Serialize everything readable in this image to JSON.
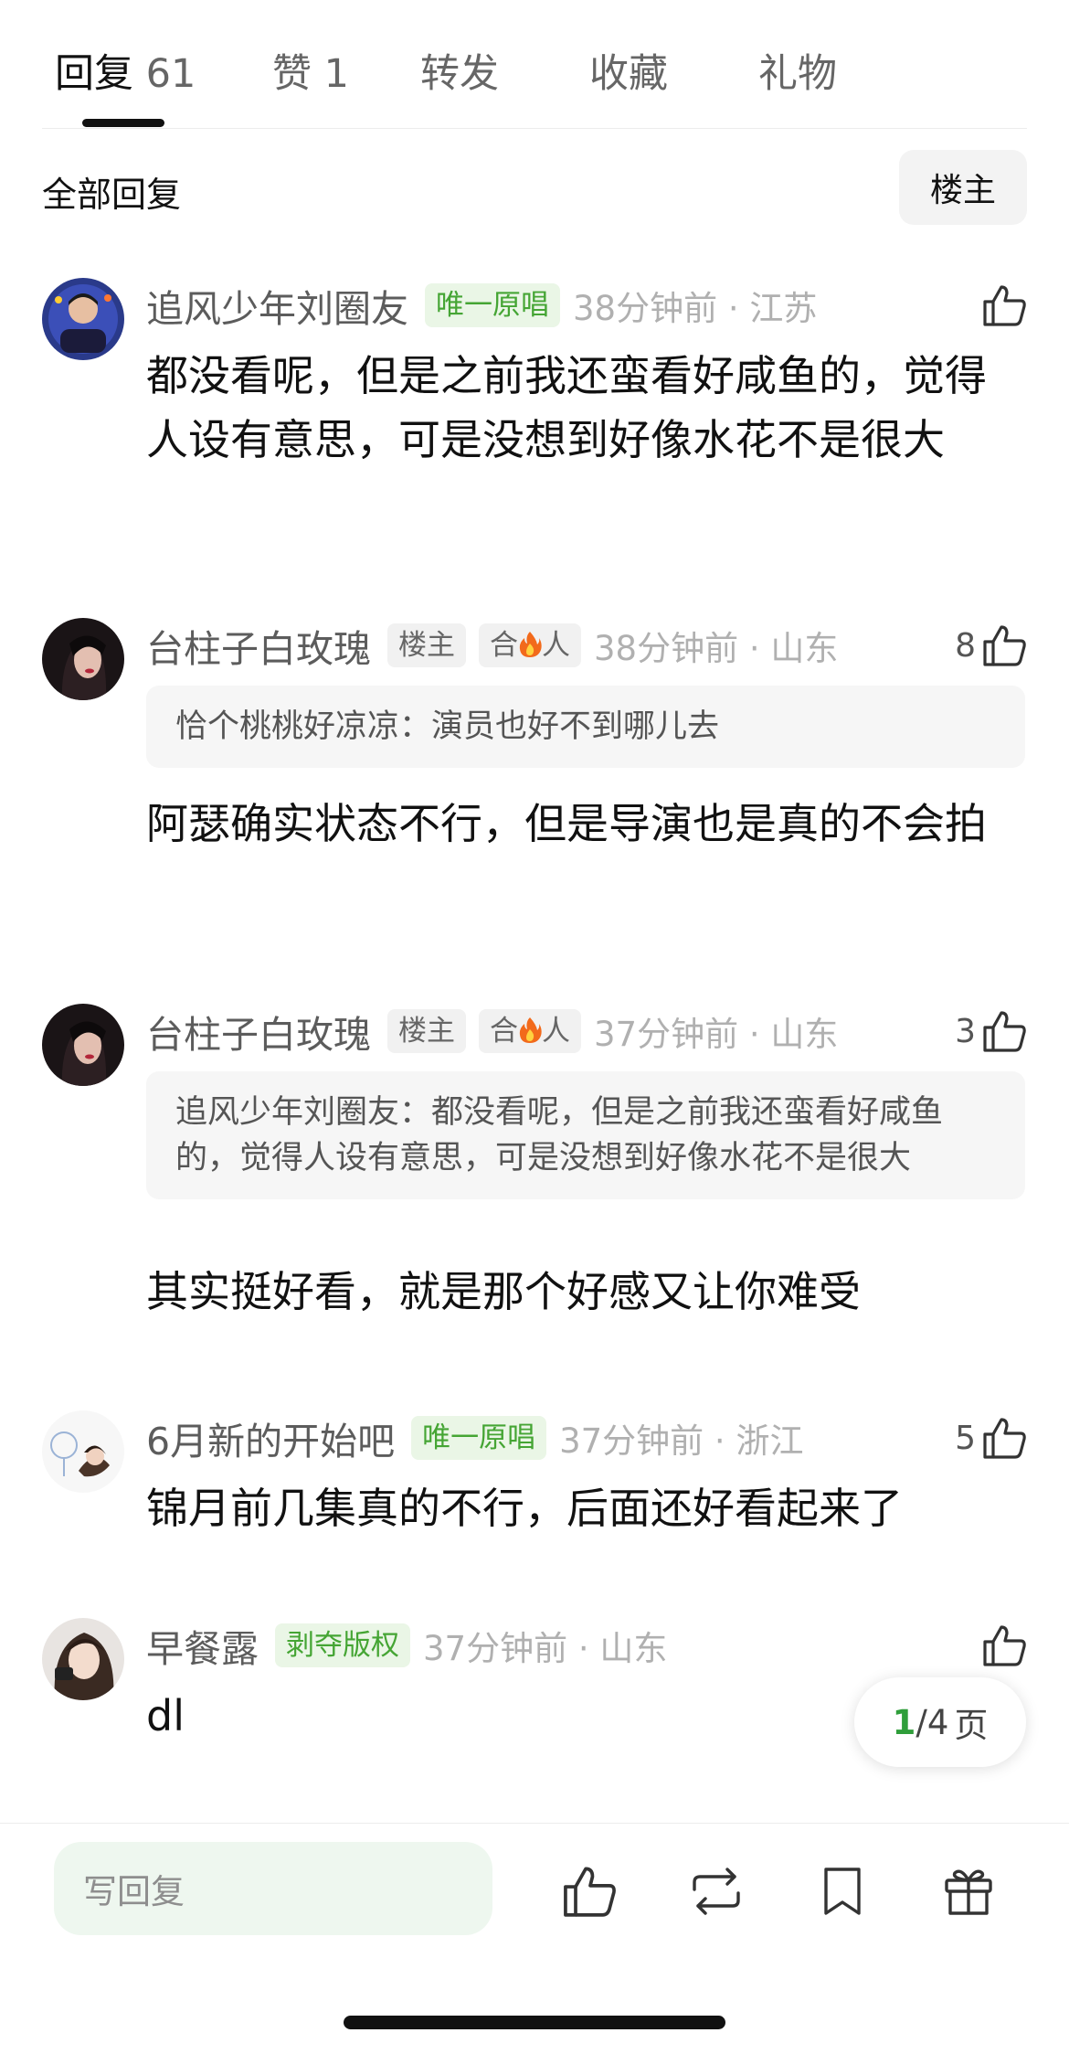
{
  "tabs": [
    {
      "label": "回复",
      "count": "61"
    },
    {
      "label": "赞",
      "count": "1"
    },
    {
      "label": "转发",
      "count": ""
    },
    {
      "label": "收藏",
      "count": ""
    },
    {
      "label": "礼物",
      "count": ""
    }
  ],
  "section_title": "全部回复",
  "filter_button": "楼主",
  "comments": [
    {
      "name": "追风少年刘圈友",
      "badges": [
        "唯一原唱"
      ],
      "time": "38分钟前 · 江苏",
      "likes": "",
      "text": "都没看呢，但是之前我还蛮看好咸鱼的，觉得人设有意思，可是没想到好像水花不是很大"
    },
    {
      "name": "台柱子白玫瑰",
      "badges": [
        "楼主",
        "合",
        "人"
      ],
      "time": "38分钟前 · 山东",
      "likes": "8",
      "quote": "恰个桃桃好凉凉：演员也好不到哪儿去",
      "text": "阿瑟确实状态不行，但是导演也是真的不会拍"
    },
    {
      "name": "台柱子白玫瑰",
      "badges": [
        "楼主",
        "合",
        "人"
      ],
      "time": "37分钟前 · 山东",
      "likes": "3",
      "quote": "追风少年刘圈友：都没看呢，但是之前我还蛮看好咸鱼的，觉得人设有意思，可是没想到好像水花不是很大",
      "text": "其实挺好看，就是那个好感又让你难受"
    },
    {
      "name": "6月新的开始吧",
      "badges": [
        "唯一原唱"
      ],
      "time": "37分钟前 · 浙江",
      "likes": "5",
      "text": "锦月前几集真的不行，后面还好看起来了"
    },
    {
      "name": "早餐露",
      "badges": [
        "剥夺版权"
      ],
      "time": "37分钟前 · 山东",
      "likes": "",
      "text": "dl"
    }
  ],
  "pager": {
    "current": "1",
    "total": "/4",
    "unit": "页"
  },
  "bottom_bar": {
    "placeholder": "写回复"
  },
  "colors": {
    "accent_green": "#2f9e3a",
    "badge_green": "#45a534",
    "badge_green_bg": "#eaf6e6",
    "input_bg": "#eef7ef"
  }
}
